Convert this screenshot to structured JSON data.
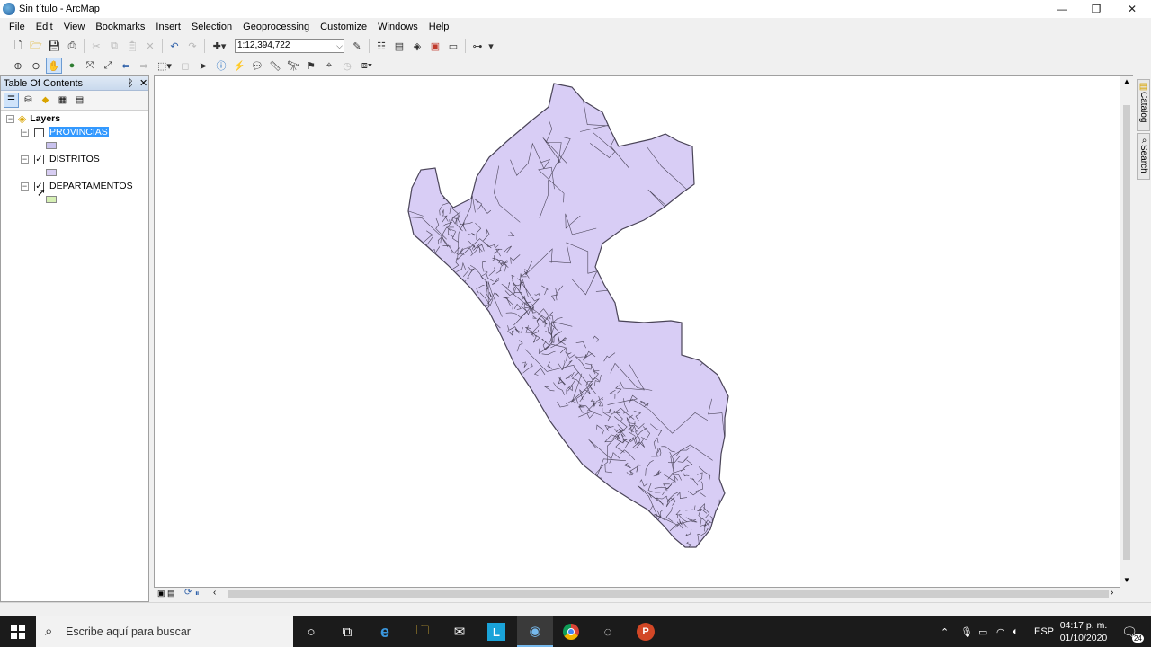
{
  "window": {
    "title": "Sin título - ArcMap",
    "min": "—",
    "max": "❐",
    "close": "✕"
  },
  "menu": [
    "File",
    "Edit",
    "View",
    "Bookmarks",
    "Insert",
    "Selection",
    "Geoprocessing",
    "Customize",
    "Windows",
    "Help"
  ],
  "toolbar": {
    "scale": "1:12,394,722"
  },
  "toc": {
    "title": "Table Of Contents",
    "pin": "ᛒ",
    "close": "✕",
    "root": "Layers",
    "layers": [
      {
        "name": "PROVINCIAS",
        "checked": false,
        "selected": true,
        "color": "#c9c2ee"
      },
      {
        "name": "DISTRITOS",
        "checked": true,
        "selected": false,
        "color": "#d7cdf2"
      },
      {
        "name": "DEPARTAMENTOS",
        "checked": true,
        "selected": false,
        "color": "#d6f0b4"
      }
    ]
  },
  "map": {
    "fill": "#d8cdf5",
    "stroke": "#4a4458"
  },
  "dock": {
    "catalog": "Catalog",
    "search": "Search"
  },
  "taskbar": {
    "search_placeholder": "Escribe aquí para buscar",
    "lang": "ESP",
    "time": "04:17 p. m.",
    "date": "01/10/2020",
    "notifications": "24"
  }
}
